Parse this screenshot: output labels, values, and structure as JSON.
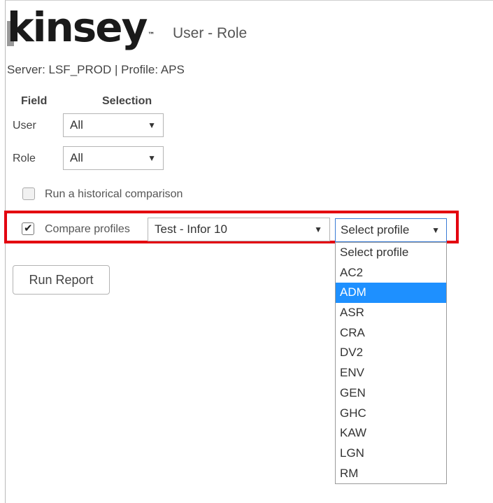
{
  "header": {
    "logo_text": "kinsey",
    "page_title": "User - Role",
    "server_info": "Server: LSF_PROD | Profile: APS"
  },
  "filters": {
    "field_heading": "Field",
    "selection_heading": "Selection",
    "user": {
      "label": "User",
      "value": "All"
    },
    "role": {
      "label": "Role",
      "value": "All"
    }
  },
  "options": {
    "historical": {
      "label": "Run a historical comparison",
      "checked": false
    },
    "compare": {
      "label": "Compare profiles",
      "checked": true
    },
    "compare_server_value": "Test - Infor 10",
    "profile_select_value": "Select profile"
  },
  "actions": {
    "run_label": "Run Report"
  },
  "profile_dropdown": {
    "selected": "ADM",
    "items": [
      "Select profile",
      "AC2",
      "ADM",
      "ASR",
      "CRA",
      "DV2",
      "ENV",
      "GEN",
      "GHC",
      "KAW",
      "LGN",
      "RM"
    ]
  },
  "colors": {
    "highlight": "#e3000f",
    "selected_option": "#1e90ff"
  }
}
